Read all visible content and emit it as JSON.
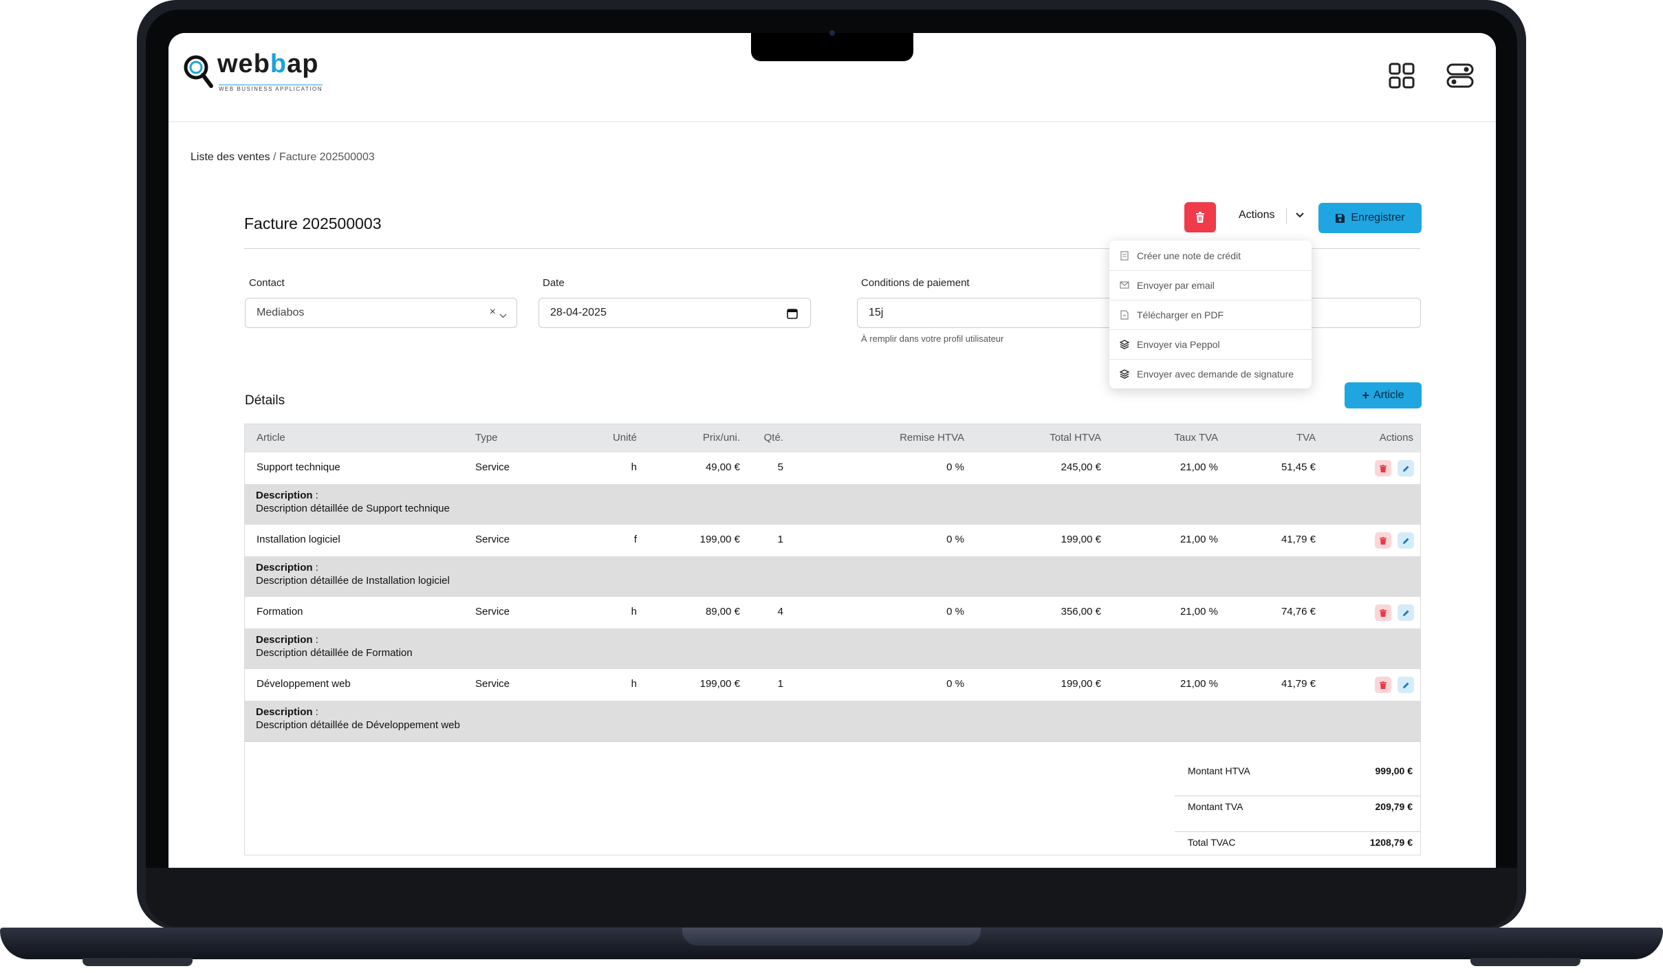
{
  "app": {
    "logo_text_1": "web",
    "logo_text_b": "b",
    "logo_text_2": "ap",
    "logo_subtitle": "WEB BUSINESS APPLICATION",
    "header_icons": [
      "grid-icon",
      "toggle-settings-icon"
    ]
  },
  "breadcrumb": {
    "parent": "Liste des ventes",
    "separator": " / ",
    "current": "Facture 202500003"
  },
  "page_title": "Facture 202500003",
  "toolbar": {
    "actions_label": "Actions",
    "save_label": "Enregistrer"
  },
  "actions_menu": [
    {
      "label": "Créer une note de crédit",
      "icon": "document-icon"
    },
    {
      "label": "Envoyer par email",
      "icon": "email-icon"
    },
    {
      "label": "Télécharger en PDF",
      "icon": "pdf-file-icon"
    },
    {
      "label": "Envoyer via Peppol",
      "icon": "layers-icon"
    },
    {
      "label": "Envoyer avec demande de signature",
      "icon": "layers-icon"
    }
  ],
  "form": {
    "contact_label": "Contact",
    "contact_value": "Mediabos",
    "date_label": "Date",
    "date_value": "28-04-2025",
    "conditions_label": "Conditions de paiement",
    "conditions_value": "15j",
    "conditions_hint": "À remplir dans votre profil utilisateur"
  },
  "details": {
    "section_title": "Détails",
    "add_article_label": "Article",
    "columns": [
      "Article",
      "Type",
      "Unité",
      "Prix/uni.",
      "Qté.",
      "Remise HTVA",
      "Total HTVA",
      "Taux TVA",
      "TVA",
      "Actions"
    ],
    "description_label": "Description",
    "rows": [
      {
        "article": "Support technique",
        "type": "Service",
        "unit": "h",
        "price": "49,00 €",
        "qty": "5",
        "discount": "0 %",
        "total_htva": "245,00 €",
        "vat_rate": "21,00 %",
        "vat": "51,45 €",
        "description": "Description détaillée de Support technique"
      },
      {
        "article": "Installation logiciel",
        "type": "Service",
        "unit": "f",
        "price": "199,00 €",
        "qty": "1",
        "discount": "0 %",
        "total_htva": "199,00 €",
        "vat_rate": "21,00 %",
        "vat": "41,79 €",
        "description": "Description détaillée de Installation logiciel"
      },
      {
        "article": "Formation",
        "type": "Service",
        "unit": "h",
        "price": "89,00 €",
        "qty": "4",
        "discount": "0 %",
        "total_htva": "356,00 €",
        "vat_rate": "21,00 %",
        "vat": "74,76 €",
        "description": "Description détaillée de Formation"
      },
      {
        "article": "Développement web",
        "type": "Service",
        "unit": "h",
        "price": "199,00 €",
        "qty": "1",
        "discount": "0 %",
        "total_htva": "199,00 €",
        "vat_rate": "21,00 %",
        "vat": "41,79 €",
        "description": "Description détaillée de Développement web"
      }
    ]
  },
  "totals": [
    {
      "label": "Montant HTVA",
      "value": "999,00 €"
    },
    {
      "label": "Montant TVA",
      "value": "209,79  €"
    },
    {
      "label": "Total TVAC",
      "value": "1208,79 €"
    }
  ],
  "colors": {
    "primary": "#1fa6e0",
    "danger": "#ef3b4a",
    "laptop": "#1c1f26"
  }
}
